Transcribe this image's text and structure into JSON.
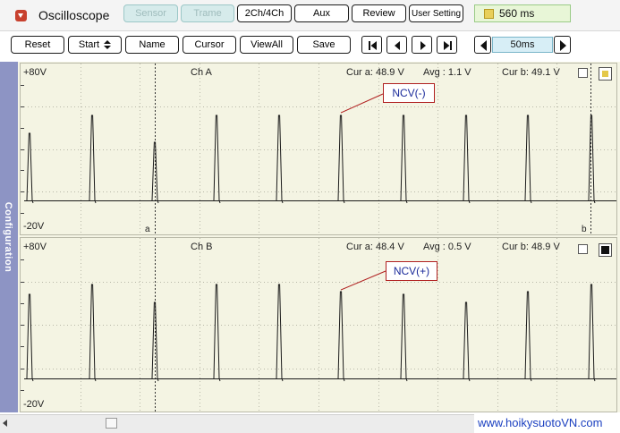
{
  "app": {
    "title": "Oscilloscope",
    "icon": "dropdown-triangle-icon"
  },
  "top_tabs": [
    {
      "label": "Sensor",
      "enabled": false
    },
    {
      "label": "Trame",
      "enabled": false
    },
    {
      "label": "2Ch/4Ch",
      "enabled": true
    },
    {
      "label": "Aux",
      "enabled": true
    },
    {
      "label": "Review",
      "enabled": true
    },
    {
      "label": "User Setting",
      "enabled": true
    }
  ],
  "status": {
    "battery_icon": "battery-icon",
    "value": "560 ms"
  },
  "toolbar": {
    "reset": "Reset",
    "start": "Start",
    "name": "Name",
    "cursor": "Cursor",
    "viewall": "ViewAll",
    "save": "Save"
  },
  "nav_icons": [
    "skip-first-icon",
    "prev-icon",
    "next-icon",
    "skip-last-icon"
  ],
  "timebase": {
    "value": "50ms",
    "dec_icon": "time-decrease-icon",
    "inc_icon": "time-increase-icon"
  },
  "sidebar": {
    "label": "Configuration"
  },
  "channels": [
    {
      "name": "Ch A",
      "y_max_label": "+80V",
      "y_min_label": "-20V",
      "cur_a": "Cur a: 48.9 V",
      "avg": "Avg : 1.1 V",
      "cur_b": "Cur b: 49.1 V",
      "cursor_a_label": "a",
      "cursor_b_label": "b",
      "annotation": "NCV(-)",
      "accent": "#e4c84a"
    },
    {
      "name": "Ch B",
      "y_max_label": "+80V",
      "y_min_label": "-20V",
      "cur_a": "Cur a: 48.4 V",
      "avg": "Avg : 0.5 V",
      "cur_b": "Cur b: 48.9 V",
      "annotation": "NCV(+)",
      "accent": "#111111"
    }
  ],
  "watermark": "www.hoikysuotoVN.com",
  "colors": {
    "trace": "#1a1a1a",
    "annotation_border": "#b02020",
    "annotation_text": "#1a2a9a",
    "status_bg": "#e8f6d7"
  }
}
